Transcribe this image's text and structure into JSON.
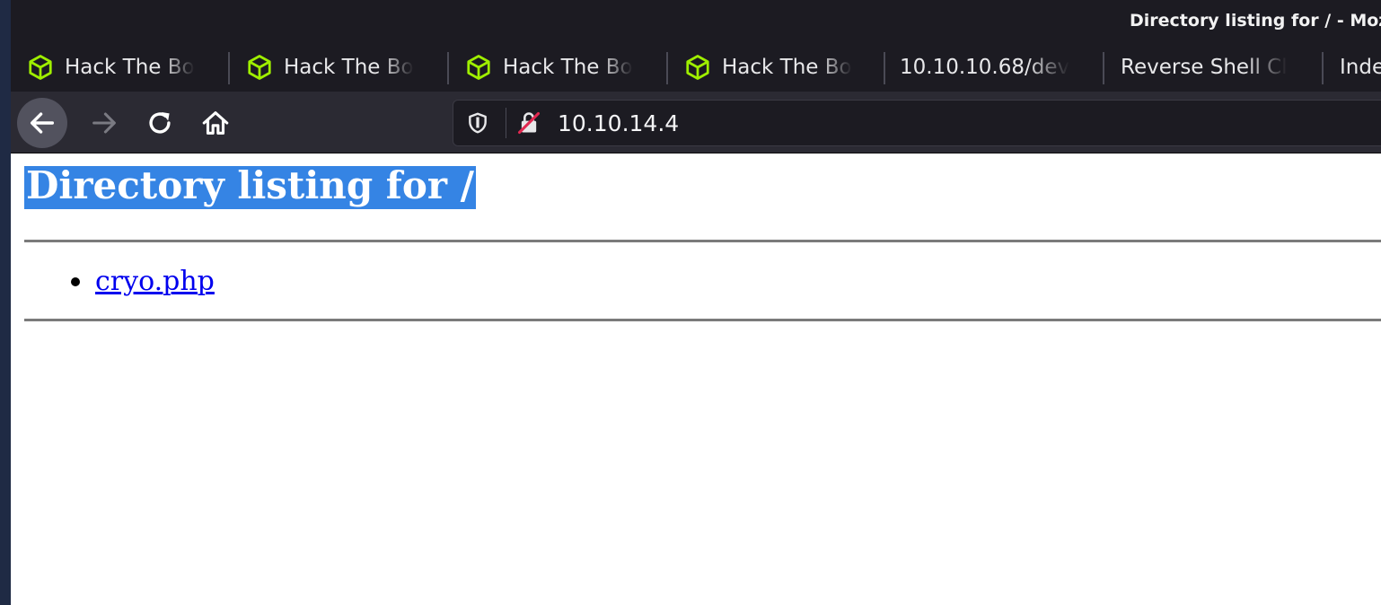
{
  "window": {
    "title": "Directory listing for / - Mozi"
  },
  "tabs": [
    {
      "label": "Hack The Bo",
      "icon": "htb-cube-icon"
    },
    {
      "label": "Hack The Bo",
      "icon": "htb-cube-icon"
    },
    {
      "label": "Hack The Bo",
      "icon": "htb-cube-icon"
    },
    {
      "label": "Hack The Bo",
      "icon": "htb-cube-icon"
    },
    {
      "label": "10.10.10.68/dev"
    },
    {
      "label": "Reverse Shell Cl"
    },
    {
      "label": "Inde"
    }
  ],
  "urlbar": {
    "url": "10.10.14.4"
  },
  "page": {
    "heading": "Directory listing for /",
    "items": [
      {
        "name": "cryo.php"
      }
    ]
  },
  "colors": {
    "chrome_bg": "#1c1b22",
    "toolbar_bg": "#2b2a33",
    "selection": "#3584e4",
    "htb_green": "#9fef00",
    "link": "#0000ee"
  }
}
